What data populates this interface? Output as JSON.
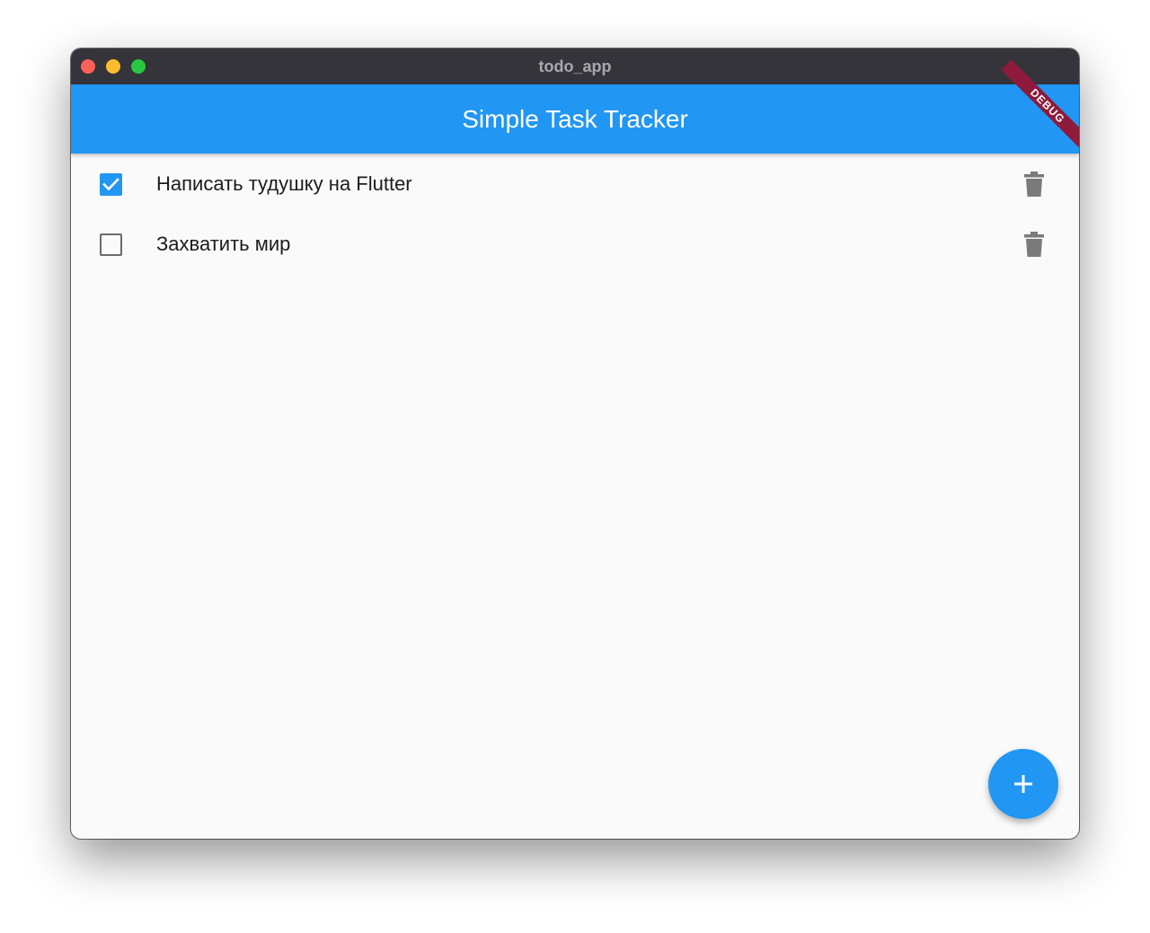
{
  "window": {
    "title": "todo_app"
  },
  "appbar": {
    "title": "Simple Task Tracker",
    "color": "#2196f3",
    "debug_banner": "DEBUG"
  },
  "tasks": [
    {
      "title": "Написать тудушку на Flutter",
      "done": true,
      "delete_icon": "trash-icon"
    },
    {
      "title": "Захватить мир",
      "done": false,
      "delete_icon": "trash-icon"
    }
  ],
  "fab": {
    "icon": "plus-icon",
    "color": "#2196f3"
  }
}
